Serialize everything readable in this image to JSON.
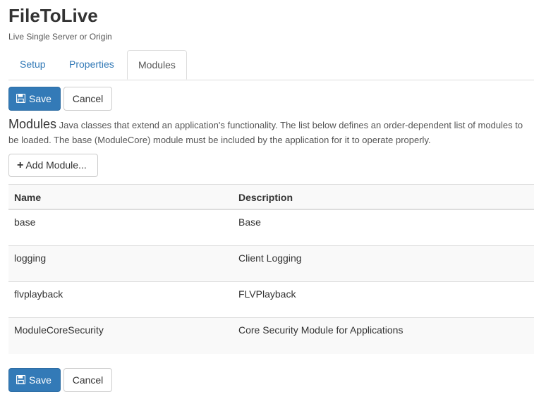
{
  "header": {
    "title": "FileToLive",
    "subtitle": "Live Single Server or Origin"
  },
  "tabs": [
    {
      "label": "Setup",
      "active": false
    },
    {
      "label": "Properties",
      "active": false
    },
    {
      "label": "Modules",
      "active": true
    }
  ],
  "actions": {
    "save_label": "Save",
    "cancel_label": "Cancel"
  },
  "modules": {
    "heading": "Modules",
    "description": "Java classes that extend an application's functionality. The list below defines an order-dependent list of modules to be loaded. The base (ModuleCore) module must be included by the application for it to operate properly.",
    "add_label": "Add Module...",
    "columns": {
      "name": "Name",
      "description": "Description"
    },
    "rows": [
      {
        "name": "base",
        "description": "Base"
      },
      {
        "name": "logging",
        "description": "Client Logging"
      },
      {
        "name": "flvplayback",
        "description": "FLVPlayback"
      },
      {
        "name": "ModuleCoreSecurity",
        "description": "Core Security Module for Applications"
      }
    ]
  },
  "colors": {
    "primary": "#337ab7",
    "link": "#337ab7",
    "border": "#dddddd",
    "stripe": "#f9f9f9"
  },
  "icons": {
    "save": "floppy-disk-icon",
    "add": "plus-icon"
  }
}
